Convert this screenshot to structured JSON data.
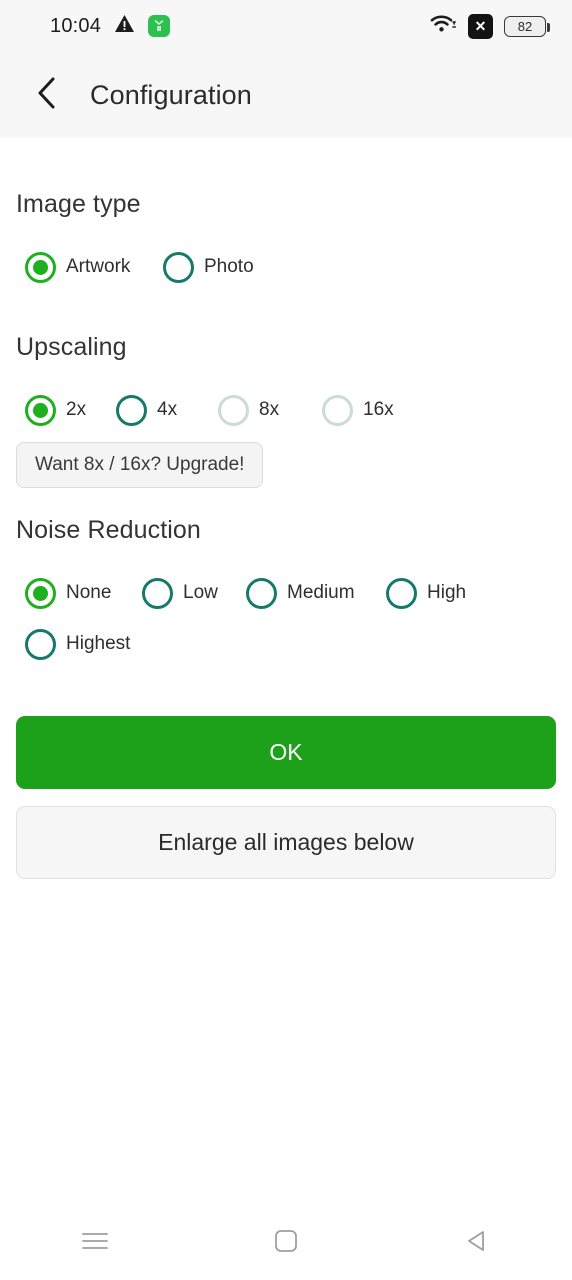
{
  "status_bar": {
    "time": "10:04",
    "warning_icon": "warning-triangle-icon",
    "app_icon": "green-app-icon",
    "wifi_icon": "wifi-icon",
    "nosim_icon": "no-sim-icon",
    "nosim_glyph": "✕",
    "battery_level": "82"
  },
  "app_bar": {
    "back_icon": "back-chevron-icon",
    "title": "Configuration"
  },
  "sections": {
    "image_type": {
      "title": "Image type",
      "options": [
        {
          "label": "Artwork",
          "state": "selected"
        },
        {
          "label": "Photo",
          "state": "unselected"
        }
      ]
    },
    "upscaling": {
      "title": "Upscaling",
      "options": [
        {
          "label": "2x",
          "state": "selected"
        },
        {
          "label": "4x",
          "state": "unselected"
        },
        {
          "label": "8x",
          "state": "disabled"
        },
        {
          "label": "16x",
          "state": "disabled"
        }
      ],
      "upgrade_label": "Want 8x / 16x? Upgrade!"
    },
    "noise_reduction": {
      "title": "Noise Reduction",
      "options": [
        {
          "label": "None",
          "state": "selected"
        },
        {
          "label": "Low",
          "state": "unselected"
        },
        {
          "label": "Medium",
          "state": "unselected"
        },
        {
          "label": "High",
          "state": "unselected"
        },
        {
          "label": "Highest",
          "state": "unselected"
        }
      ]
    }
  },
  "actions": {
    "ok_label": "OK",
    "enlarge_label": "Enlarge all images below"
  },
  "nav_bar": {
    "recents_icon": "recents-menu-icon",
    "home_icon": "home-square-icon",
    "back_icon": "back-triangle-icon"
  },
  "colors": {
    "accent_green": "#1fb01f",
    "button_green": "#1ea11a",
    "radio_teal": "#17796b",
    "radio_disabled": "#c8dcd8",
    "header_bg": "#f7f7f7"
  }
}
